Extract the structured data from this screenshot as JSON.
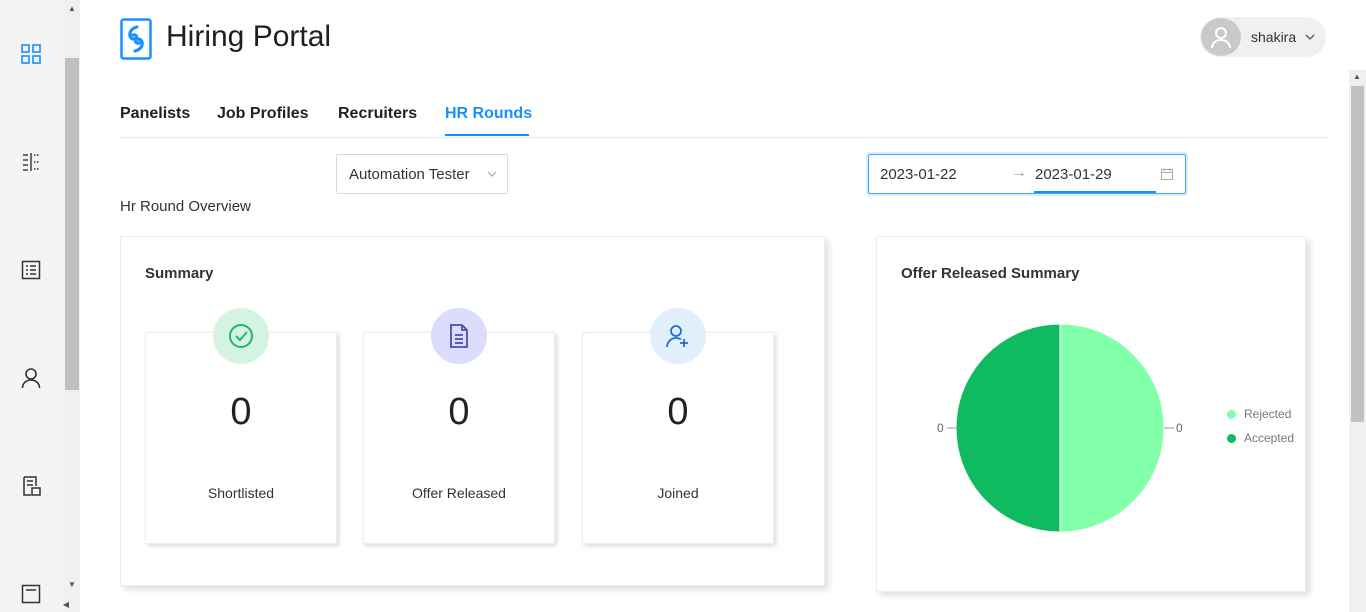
{
  "app": {
    "title": "Hiring Portal"
  },
  "user": {
    "name": "shakira"
  },
  "sidebar": {
    "icons": [
      "dashboard-icon",
      "panel-icon",
      "list-icon",
      "user-icon",
      "report-icon",
      "document-icon"
    ]
  },
  "tabs": [
    {
      "label": "Panelists",
      "active": false
    },
    {
      "label": "Job Profiles",
      "active": false
    },
    {
      "label": "Recruiters",
      "active": false
    },
    {
      "label": "HR Rounds",
      "active": true
    }
  ],
  "filters": {
    "job_profile": "Automation Tester",
    "date_from": "2023-01-22",
    "date_to": "2023-01-29",
    "date_separator": "→"
  },
  "overview": {
    "title": "Hr Round Overview"
  },
  "summary": {
    "title": "Summary",
    "stats": [
      {
        "label": "Shortlisted",
        "value": "0",
        "icon": "check-circle-icon",
        "bg": "#d4f3e2",
        "color": "#20b86a"
      },
      {
        "label": "Offer Released",
        "value": "0",
        "icon": "document-icon",
        "bg": "#dcdcfc",
        "color": "#4a4fb0"
      },
      {
        "label": "Joined",
        "value": "0",
        "icon": "user-add-icon",
        "bg": "#e1eefc",
        "color": "#1f6fd0"
      }
    ]
  },
  "offer_chart": {
    "title": "Offer Released Summary",
    "label_left": "0",
    "label_right": "0"
  },
  "chart_data": {
    "type": "pie",
    "title": "Offer Released Summary",
    "slices": [
      {
        "name": "Rejected",
        "value": 0,
        "color": "#82ffa9"
      },
      {
        "name": "Accepted",
        "value": 0,
        "color": "#0fba61"
      }
    ],
    "legend": "right"
  }
}
